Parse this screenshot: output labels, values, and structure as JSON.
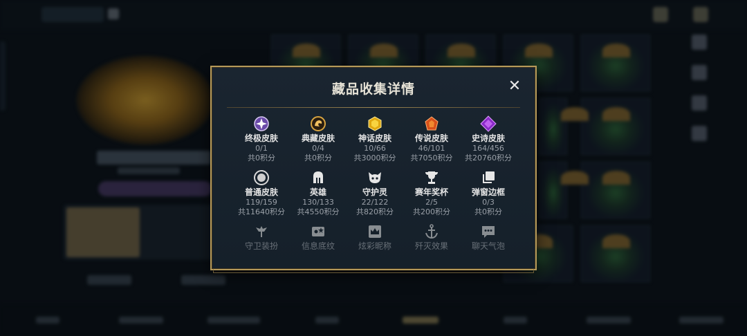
{
  "modal": {
    "title": "藏品收集详情",
    "close_label": "✕"
  },
  "rows": [
    [
      {
        "name": "终极皮肤",
        "count": "0/1",
        "points": "共0积分",
        "icon": "ultimate-gem-icon"
      },
      {
        "name": "典藏皮肤",
        "count": "0/4",
        "points": "共0积分",
        "icon": "dragon-crest-icon"
      },
      {
        "name": "神话皮肤",
        "count": "10/66",
        "points": "共3000积分",
        "icon": "mythic-gem-icon"
      },
      {
        "name": "传说皮肤",
        "count": "46/101",
        "points": "共7050积分",
        "icon": "legendary-gem-icon"
      },
      {
        "name": "史诗皮肤",
        "count": "164/456",
        "points": "共20760积分",
        "icon": "epic-gem-icon"
      }
    ],
    [
      {
        "name": "普通皮肤",
        "count": "119/159",
        "points": "共11640积分",
        "icon": "circle-icon"
      },
      {
        "name": "英雄",
        "count": "130/133",
        "points": "共4550积分",
        "icon": "helmet-icon"
      },
      {
        "name": "守护灵",
        "count": "22/122",
        "points": "共820积分",
        "icon": "guardian-face-icon"
      },
      {
        "name": "赛年奖杯",
        "count": "2/5",
        "points": "共200积分",
        "icon": "trophy-icon"
      },
      {
        "name": "弹窗边框",
        "count": "0/3",
        "points": "共0积分",
        "icon": "frame-stack-icon"
      }
    ],
    [
      {
        "name": "守卫装扮",
        "icon": "ward-icon"
      },
      {
        "name": "信息底纹",
        "icon": "card-pattern-icon"
      },
      {
        "name": "炫彩昵称",
        "icon": "crown-nameplate-icon"
      },
      {
        "name": "歼灭效果",
        "icon": "anchor-icon"
      },
      {
        "name": "聊天气泡",
        "icon": "chat-bubble-icon"
      }
    ]
  ]
}
